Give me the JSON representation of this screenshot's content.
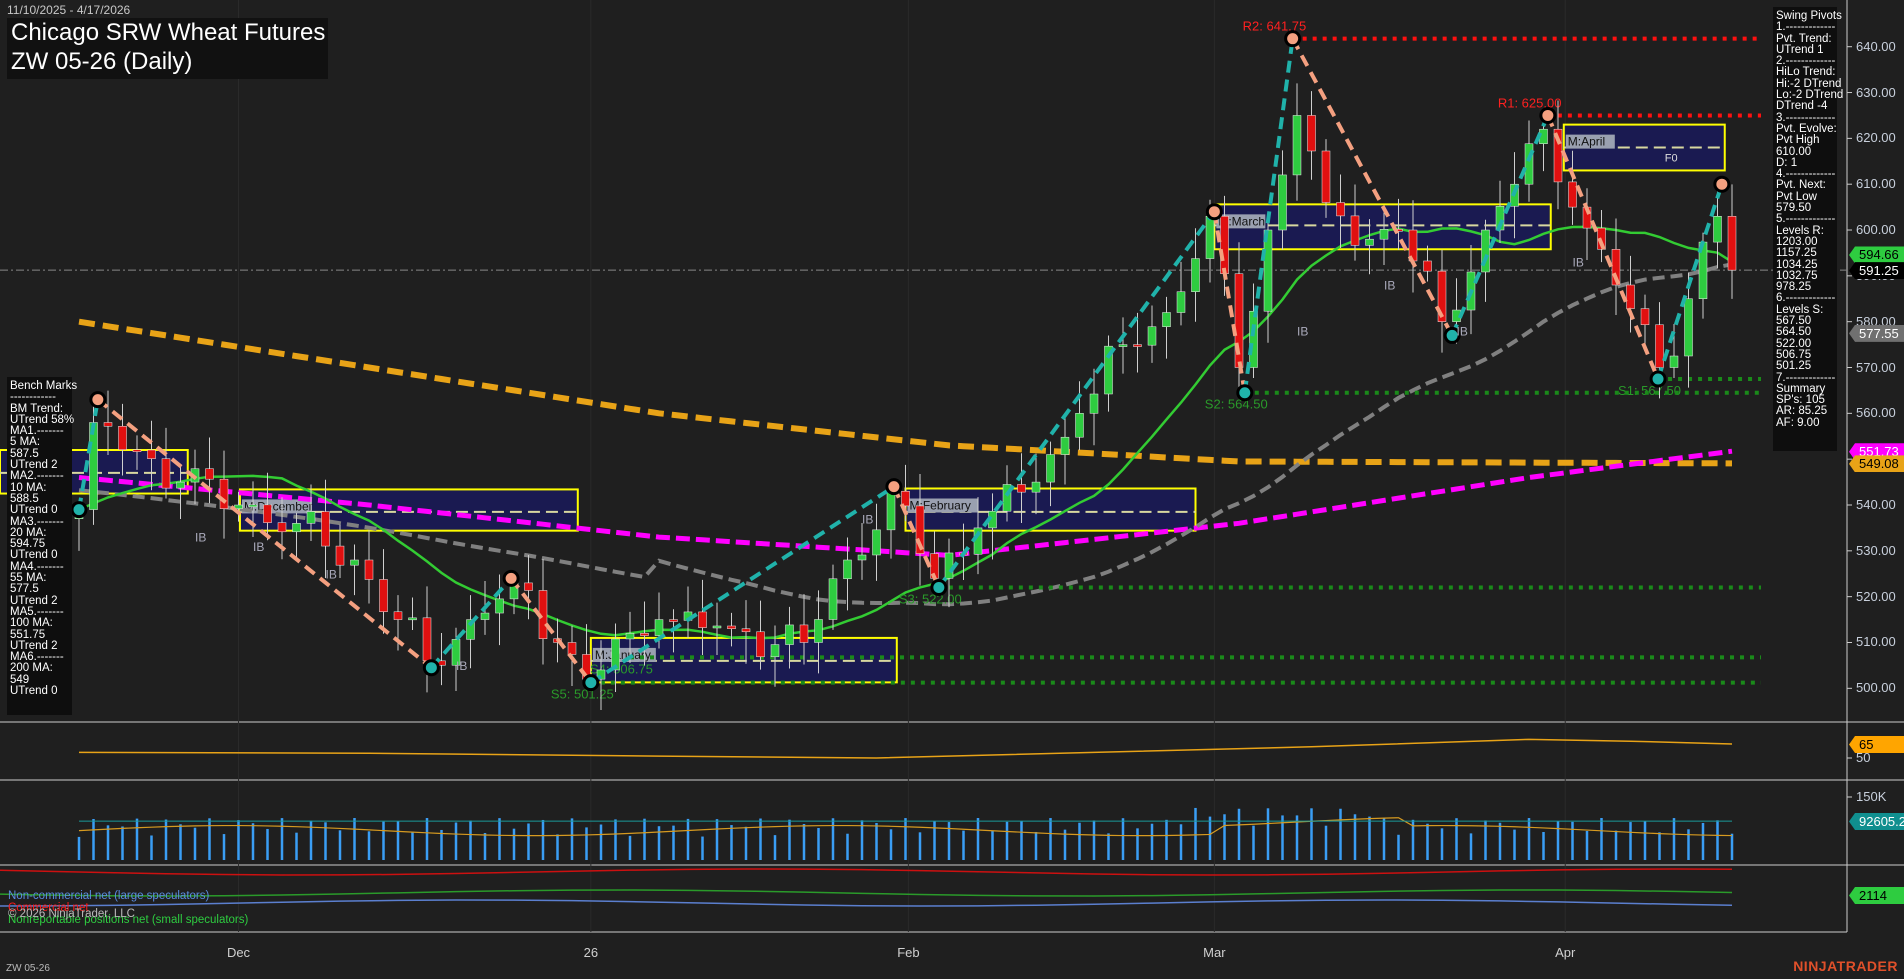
{
  "header": {
    "date_range": "11/10/2025 - 4/17/2026",
    "title_line1": "Chicago SRW Wheat Futures",
    "title_line2": "ZW 05-26 (Daily)"
  },
  "swing_pivots": [
    "Swing Pivots",
    "1.-------------",
    "Pvt. Trend:",
    "UTrend 1",
    "2.-------------",
    "HiLo Trend:",
    "Hi:-2 DTrend",
    "Lo:-2 DTrend",
    "DTrend -4",
    "3.-------------",
    "Pvt. Evolve:",
    "Pvt High",
    "610.00",
    "D: 1",
    "4.-------------",
    "Pvt. Next:",
    "Pvt Low",
    "579.50",
    "5.-------------",
    "Levels R:",
    "1203.00",
    "1157.25",
    "1034.25",
    "1032.75",
    "978.25",
    "6.-------------",
    "Levels S:",
    "567.50",
    "564.50",
    "522.00",
    "506.75",
    "501.25",
    "7.-------------",
    "Summary",
    "SP's: 105",
    "AR: 85.25",
    "AF: 9.00"
  ],
  "bench_marks": [
    "Bench Marks",
    "------------",
    "BM Trend:",
    "UTrend 58%",
    "MA1.-------",
    "5 MA:",
    "587.5",
    "UTrend 2",
    "MA2.-------",
    "10 MA:",
    "588.5",
    "UTrend 0",
    "MA3.-------",
    "20 MA:",
    "594.75",
    "UTrend 0",
    "MA4.-------",
    "55 MA:",
    "577.5",
    "UTrend 2",
    "MA5.-------",
    "100 MA:",
    "551.75",
    "UTrend 2",
    "MA6.-------",
    "200 MA:",
    "549",
    "UTrend 0"
  ],
  "price_tags": [
    {
      "value": "594.66",
      "bg": "#2ecc40",
      "fg": "#000",
      "price": 594.66
    },
    {
      "value": "591.25",
      "bg": "#000000",
      "fg": "#fff",
      "price": 591.25
    },
    {
      "value": "577.55",
      "bg": "#707070",
      "fg": "#fff",
      "price": 577.55
    },
    {
      "value": "551.73",
      "bg": "#ff00ff",
      "fg": "#fff",
      "price": 551.73
    },
    {
      "value": "549.08",
      "bg": "#e8a317",
      "fg": "#000",
      "price": 549.08
    }
  ],
  "osc_tag": {
    "value": "65",
    "tick": "50"
  },
  "volume_tags": {
    "tick": "150K",
    "main": "92605.24"
  },
  "cot_tag": {
    "value": "2114"
  },
  "x_labels": [
    {
      "text": "Dec",
      "bar": 11
    },
    {
      "text": "26",
      "bar": 35.3
    },
    {
      "text": "Feb",
      "bar": 57.2
    },
    {
      "text": "Mar",
      "bar": 78.3
    },
    {
      "text": "Apr",
      "bar": 102.5
    }
  ],
  "legend": {
    "noncommercial": "Non-commercial net (large speculators)",
    "commercial": "Commercial net",
    "nonreportable": "Nonreportable positions net (small speculators)",
    "copyright": "© 2026 NinjaTrader, LLC"
  },
  "footer": {
    "symbol": "ZW 05-26",
    "logo": "NINJATRADER"
  },
  "colors": {
    "up": "#2ecc40",
    "down": "#e01010",
    "ma200": "#e8a317",
    "ma100": "#ff00ff",
    "ma55": "#808080",
    "ma20": "#33cc33",
    "zig_up": "#20b2aa",
    "zig_down": "#f4a080",
    "resistance": "#ff1010",
    "support": "#1a8a1a",
    "box": "#ffff00",
    "box_fill": "#1a1a5a"
  },
  "chart_data": {
    "type": "candlestick",
    "title": "Chicago SRW Wheat Futures ZW 05-26 (Daily)",
    "ylim": [
      490,
      650
    ],
    "y_ticks": [
      500,
      510,
      520,
      530,
      540,
      550,
      560,
      570,
      580,
      590,
      600,
      610,
      620,
      630,
      640
    ],
    "bar_count": 115,
    "price_path": [
      [
        0,
        539
      ],
      [
        1,
        558
      ],
      [
        4,
        552
      ],
      [
        7,
        545
      ],
      [
        11,
        540
      ],
      [
        15,
        536
      ],
      [
        19,
        528
      ],
      [
        22,
        515
      ],
      [
        24,
        506
      ],
      [
        27,
        515
      ],
      [
        30,
        523
      ],
      [
        33,
        510
      ],
      [
        35,
        502
      ],
      [
        38,
        512
      ],
      [
        40,
        515
      ],
      [
        45,
        513
      ],
      [
        50,
        510
      ],
      [
        53,
        528
      ],
      [
        56,
        543
      ],
      [
        59,
        524
      ],
      [
        62,
        535
      ],
      [
        66,
        545
      ],
      [
        69,
        560
      ],
      [
        72,
        575
      ],
      [
        75,
        582
      ],
      [
        78,
        603
      ],
      [
        80,
        570
      ],
      [
        82,
        600
      ],
      [
        84,
        625
      ],
      [
        86,
        606
      ],
      [
        89,
        598
      ],
      [
        91,
        600
      ],
      [
        94,
        580
      ],
      [
        97,
        600
      ],
      [
        99,
        610
      ],
      [
        101,
        622
      ],
      [
        103,
        605
      ],
      [
        106,
        588
      ],
      [
        109,
        570
      ],
      [
        111,
        585
      ],
      [
        113,
        603
      ],
      [
        114,
        591.25
      ]
    ],
    "ma100": [
      [
        0,
        546
      ],
      [
        20,
        540
      ],
      [
        40,
        533
      ],
      [
        60,
        529
      ],
      [
        80,
        536
      ],
      [
        100,
        546
      ],
      [
        114,
        551.73
      ]
    ],
    "ma200": [
      [
        0,
        580
      ],
      [
        20,
        570
      ],
      [
        40,
        560
      ],
      [
        60,
        553
      ],
      [
        80,
        549.5
      ],
      [
        114,
        549.08
      ]
    ],
    "zigzag": [
      [
        0,
        539
      ],
      [
        1.3,
        563
      ],
      [
        24.3,
        504.5
      ],
      [
        29.8,
        524
      ],
      [
        35.3,
        501.25
      ],
      [
        56.2,
        544
      ],
      [
        59.3,
        522
      ],
      [
        78.3,
        604
      ],
      [
        80.4,
        564.5
      ],
      [
        83.7,
        641.75
      ],
      [
        94.7,
        577
      ],
      [
        101.3,
        625
      ],
      [
        108.9,
        567.5
      ],
      [
        113.3,
        610
      ]
    ],
    "levels": [
      {
        "label": "R2: 641.75",
        "price": 641.75,
        "from": 83.7,
        "kind": "R"
      },
      {
        "label": "R1: 625.00",
        "price": 625,
        "from": 101.3,
        "kind": "R"
      },
      {
        "label": "S1: 567.50",
        "price": 567.5,
        "from": 108.9,
        "kind": "S"
      },
      {
        "label": "S2: 564.50",
        "price": 564.5,
        "from": 80.4,
        "kind": "S"
      },
      {
        "label": "S3: 522.00",
        "price": 522,
        "from": 59.3,
        "kind": "S"
      },
      {
        "label": "S4: 506.75",
        "price": 506.75,
        "from": 38,
        "kind": "S"
      },
      {
        "label": "S5: 501.25",
        "price": 501.25,
        "from": 35.3,
        "kind": "S"
      }
    ],
    "months": [
      {
        "label": "",
        "from": -6,
        "to": 7.5,
        "hi": 552,
        "lo": 542.5,
        "mid": 547
      },
      {
        "label": "M:December",
        "from": 11.1,
        "to": 34.4,
        "hi": 543.4,
        "lo": 534.4,
        "mid": 538.5
      },
      {
        "label": "M:January",
        "from": 35.3,
        "to": 56.4,
        "hi": 511,
        "lo": 501.3,
        "mid": 506
      },
      {
        "label": "M:February",
        "from": 57,
        "to": 77,
        "hi": 543.6,
        "lo": 534.4,
        "mid": 538.5
      },
      {
        "label": "M:March",
        "from": 78.3,
        "to": 101.5,
        "hi": 605.6,
        "lo": 595.8,
        "mid": 601
      },
      {
        "label": "M:April",
        "from": 102.4,
        "to": 113.5,
        "hi": 623,
        "lo": 613,
        "mid": 618,
        "extra": "F0"
      }
    ],
    "ib_labels": [
      [
        8,
        532
      ],
      [
        12,
        530
      ],
      [
        17,
        524
      ],
      [
        26,
        504
      ],
      [
        84,
        577
      ],
      [
        90,
        587
      ],
      [
        95,
        577
      ],
      [
        103,
        592
      ],
      [
        54,
        536
      ]
    ],
    "ib_text": "IB",
    "oscillator": [
      [
        0,
        56
      ],
      [
        20,
        55
      ],
      [
        40,
        52
      ],
      [
        55,
        50
      ],
      [
        70,
        56
      ],
      [
        85,
        62
      ],
      [
        100,
        70
      ],
      [
        107,
        68
      ],
      [
        114,
        65
      ]
    ],
    "current_price": 591.25
  }
}
